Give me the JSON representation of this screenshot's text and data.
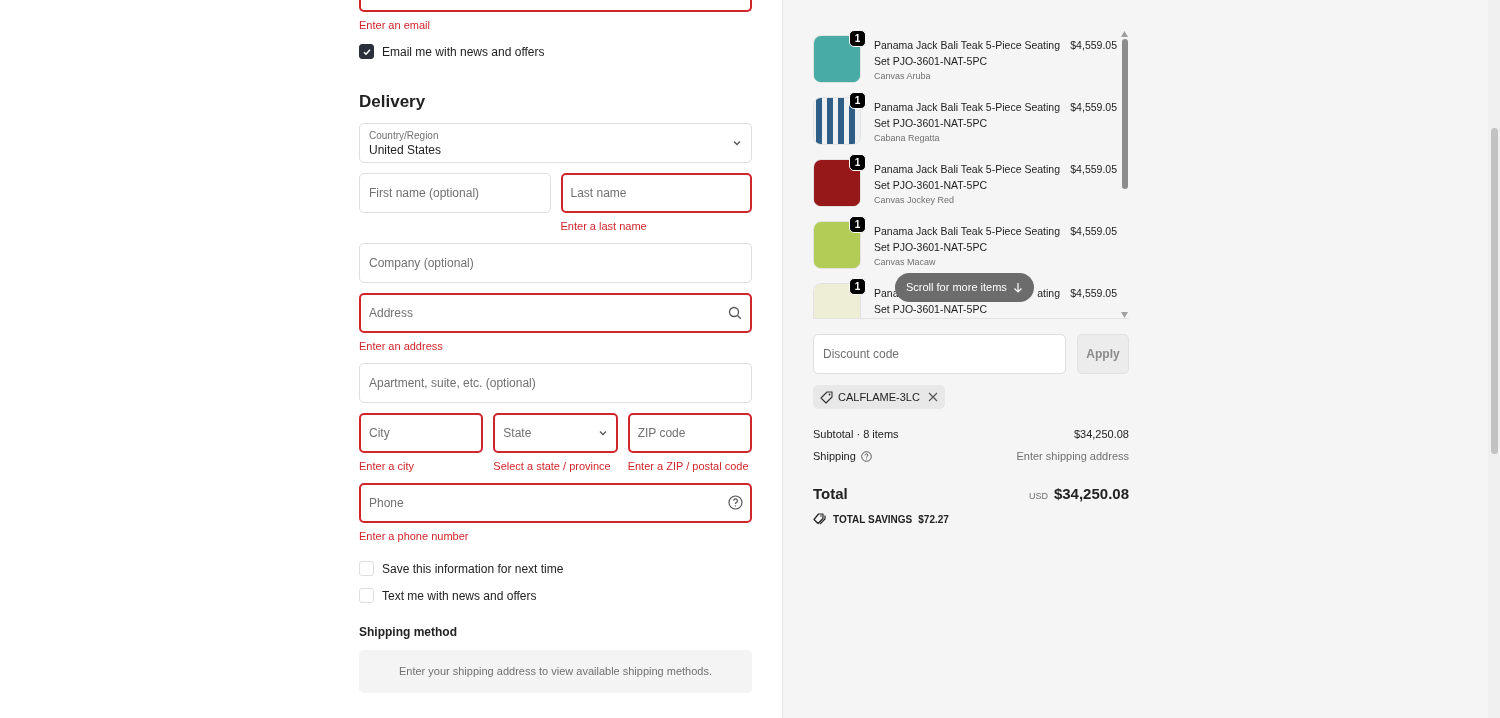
{
  "contact": {
    "email": {
      "invalid": true,
      "error": "Enter an email"
    },
    "checkboxes": [
      {
        "label": "Email me with news and offers",
        "checked": true
      }
    ]
  },
  "delivery": {
    "heading": "Delivery",
    "rows": [
      [
        {
          "kind": "select",
          "label": "Country/Region",
          "value": "United States",
          "invalid": false
        }
      ],
      [
        {
          "kind": "input",
          "placeholder": "First name (optional)",
          "invalid": false
        },
        {
          "kind": "input",
          "placeholder": "Last name",
          "invalid": true,
          "error": "Enter a last name"
        }
      ],
      [
        {
          "kind": "input",
          "placeholder": "Company (optional)",
          "invalid": false
        }
      ],
      [
        {
          "kind": "search_input",
          "placeholder": "Address",
          "invalid": true,
          "error": "Enter an address"
        }
      ],
      [
        {
          "kind": "input",
          "placeholder": "Apartment, suite, etc. (optional)",
          "invalid": false
        }
      ],
      [
        {
          "kind": "input",
          "placeholder": "City",
          "invalid": true,
          "error": "Enter a city"
        },
        {
          "kind": "select",
          "placeholder": "State",
          "invalid": true,
          "error": "Select a state / province"
        },
        {
          "kind": "input",
          "placeholder": "ZIP code",
          "invalid": true,
          "error": "Enter a ZIP / postal code"
        }
      ],
      [
        {
          "kind": "help_input",
          "placeholder": "Phone",
          "invalid": true,
          "error": "Enter a phone number"
        }
      ]
    ],
    "checkboxes": [
      {
        "label": "Save this information for next time",
        "checked": false
      },
      {
        "label": "Text me with news and offers",
        "checked": false
      }
    ]
  },
  "shipping_method": {
    "heading": "Shipping method",
    "notice": "Enter your shipping address to view available shipping methods."
  },
  "order": {
    "items": [
      {
        "kind": "solid",
        "quantity": "1",
        "title_start": [
          "Panama Jack Bali Teak 5-Piece Seating"
        ],
        "title_end": "Set PJO-3601-NAT-5PC",
        "variant": "Canvas Aruba",
        "price": "$4,559.05",
        "color": "#48aba5"
      },
      {
        "kind": "stripes",
        "quantity": "1",
        "title_start": [
          "Panama Jack Bali Teak 5-Piece Seating"
        ],
        "title_end": "Set PJO-3601-NAT-5PC",
        "variant": "Cabana Regatta",
        "price": "$4,559.05",
        "color": "#2f5f86"
      },
      {
        "kind": "solid",
        "quantity": "1",
        "title_start": [
          "Panama Jack Bali Teak 5-Piece Seating"
        ],
        "title_end": "Set PJO-3601-NAT-5PC",
        "variant": "Canvas Jockey Red",
        "price": "$4,559.05",
        "color": "#961818"
      },
      {
        "kind": "solid",
        "quantity": "1",
        "title_start": [
          "Panama Jack Bali Teak 5-Piece Seating"
        ],
        "title_end": "Set PJO-3601-NAT-5PC",
        "variant": "Canvas Macaw",
        "price": "$4,559.05",
        "color": "#b2cc55"
      },
      {
        "kind": "solid",
        "quantity": "1",
        "title_start": [
          "Pana",
          "ating"
        ],
        "title_end": "Set PJO-3601-NAT-5PC",
        "price": "$4,559.05",
        "color": "#eeeed6"
      }
    ],
    "scroll_hint": "Scroll for more items",
    "discount": {
      "placeholder": "Discount code",
      "button": "Apply"
    },
    "applied_code": "CALFLAME-3LC",
    "summary": [
      {
        "label": "Subtotal · 8 items",
        "value": "$34,250.08",
        "help": false,
        "muted": false
      },
      {
        "label": "Shipping",
        "value": "Enter shipping address",
        "help": true,
        "muted": true
      }
    ],
    "total": {
      "label": "Total",
      "currency": "USD",
      "amount": "$34,250.08"
    },
    "savings": {
      "label": "TOTAL SAVINGS",
      "amount": "$72.27"
    }
  }
}
